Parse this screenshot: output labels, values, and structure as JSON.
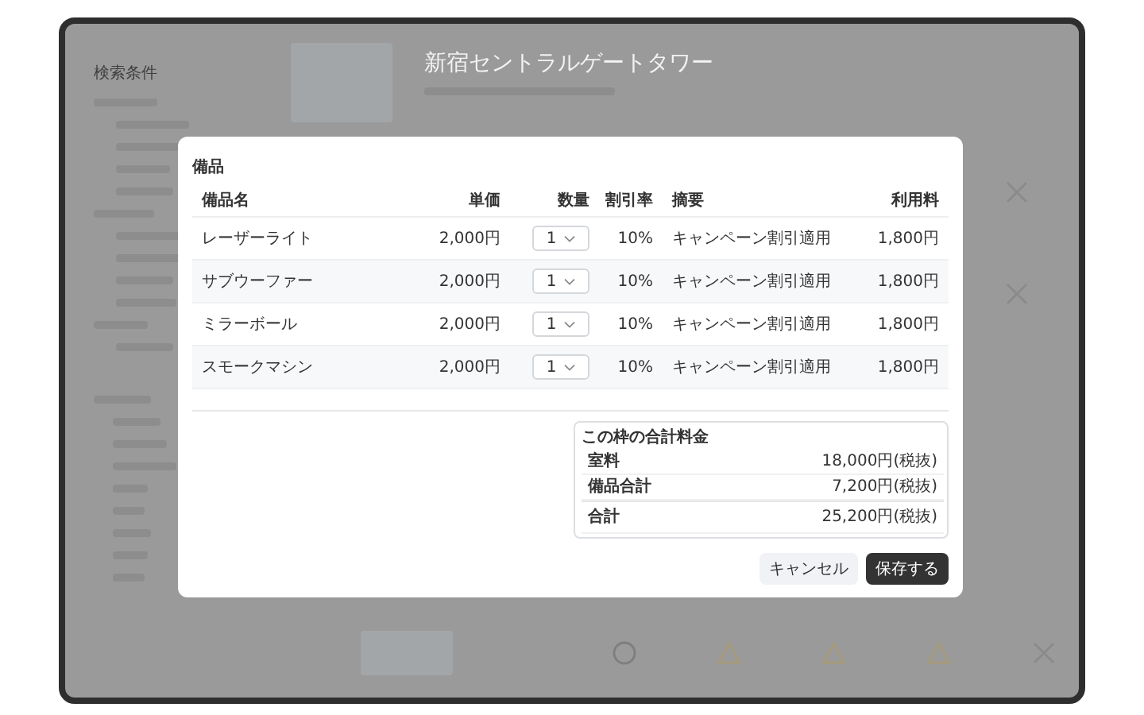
{
  "background": {
    "sidebar_title": "検索条件",
    "venue_title": "新宿セントラルゲートタワー",
    "side_marks": [
      {
        "kind": "cross"
      },
      {
        "kind": "cross"
      }
    ],
    "availability": [
      {
        "kind": "circle"
      },
      {
        "kind": "triangle"
      },
      {
        "kind": "triangle"
      },
      {
        "kind": "triangle"
      },
      {
        "kind": "cross"
      }
    ]
  },
  "modal": {
    "section_title": "備品",
    "columns": [
      "備品名",
      "単価",
      "数量",
      "割引率",
      "摘要",
      "利用料"
    ],
    "rows": [
      {
        "name": "レーザーライト",
        "unit_price": "2,000円",
        "quantity": "1",
        "discount": "10%",
        "summary": "キャンペーン割引適用",
        "fee": "1,800円"
      },
      {
        "name": "サブウーファー",
        "unit_price": "2,000円",
        "quantity": "1",
        "discount": "10%",
        "summary": "キャンペーン割引適用",
        "fee": "1,800円"
      },
      {
        "name": "ミラーボール",
        "unit_price": "2,000円",
        "quantity": "1",
        "discount": "10%",
        "summary": "キャンペーン割引適用",
        "fee": "1,800円"
      },
      {
        "name": "スモークマシン",
        "unit_price": "2,000円",
        "quantity": "1",
        "discount": "10%",
        "summary": "キャンペーン割引適用",
        "fee": "1,800円"
      }
    ],
    "summary": {
      "title": "この枠の合計料金",
      "lines": [
        {
          "label": "室料",
          "value": "18,000円(税抜)",
          "kind": "subtotal"
        },
        {
          "label": "備品合計",
          "value": "7,200円(税抜)",
          "kind": "subtotal"
        },
        {
          "label": "合計",
          "value": "25,200円(税抜)",
          "kind": "total"
        }
      ]
    },
    "buttons": [
      {
        "label": "キャンセル",
        "kind": "secondary"
      },
      {
        "label": "保存する",
        "kind": "primary"
      }
    ]
  }
}
